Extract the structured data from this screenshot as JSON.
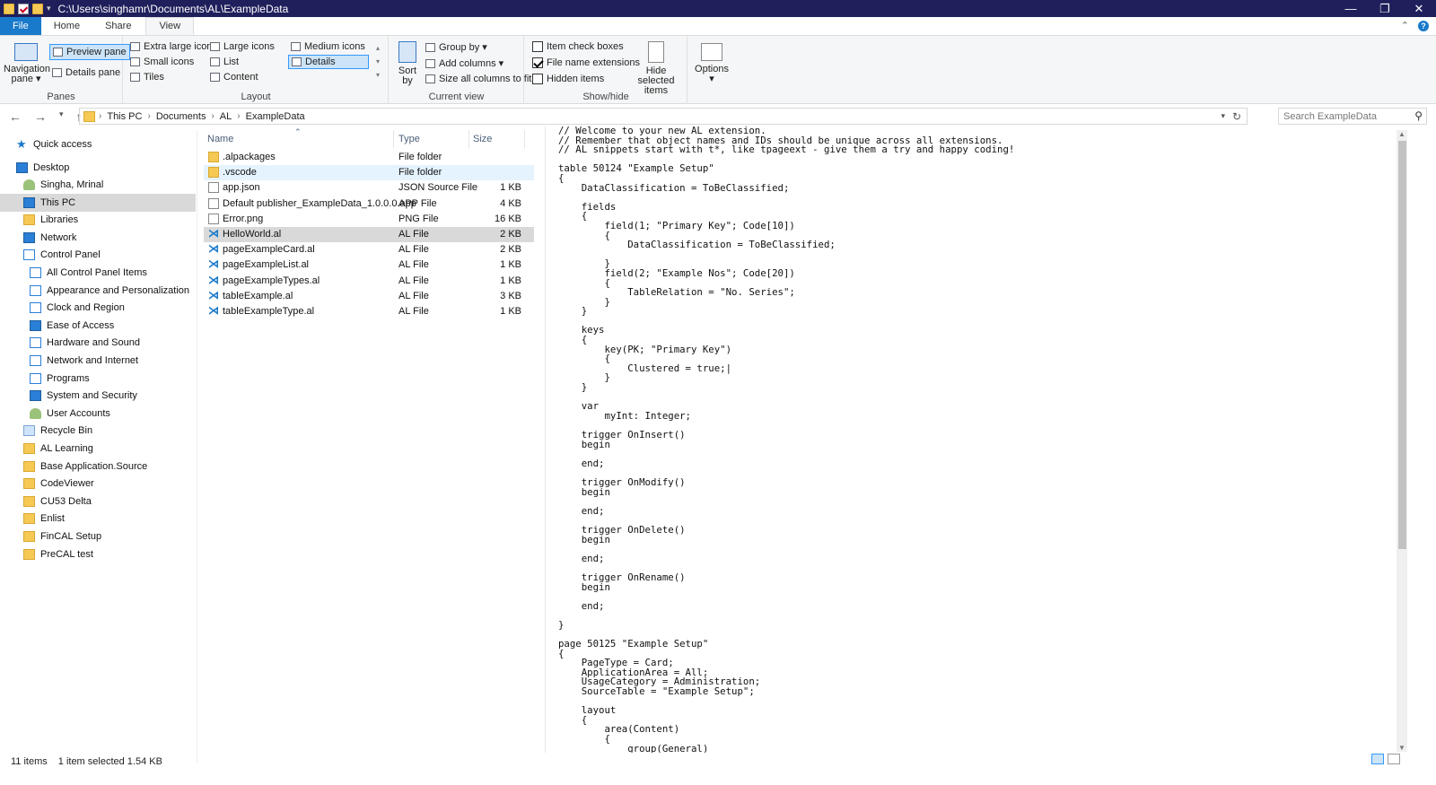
{
  "window": {
    "title_path": "C:\\Users\\singhamr\\Documents\\AL\\ExampleData",
    "minimize": "—",
    "maximize": "❐",
    "close": "✕"
  },
  "ribbon_tabs": [
    "File",
    "Home",
    "Share",
    "View"
  ],
  "ribbon": {
    "panes": {
      "label": "Panes",
      "navigation_pane": "Navigation pane ▾",
      "preview_pane": "Preview pane",
      "details_pane": "Details pane"
    },
    "layout": {
      "label": "Layout",
      "options": [
        "Extra large icons",
        "Large icons",
        "Medium icons",
        "Small icons",
        "List",
        "Details",
        "Tiles",
        "Content"
      ],
      "selected": "Details"
    },
    "current_view": {
      "label": "Current view",
      "sort_by": "Sort by",
      "group_by": "Group by ▾",
      "add_columns": "Add columns ▾",
      "size_all_columns": "Size all columns to fit"
    },
    "show_hide": {
      "label": "Show/hide",
      "item_check_boxes": "Item check boxes",
      "file_name_extensions": "File name extensions",
      "hidden_items": "Hidden items",
      "hide_selected_items": "Hide selected items",
      "checks": {
        "item_check_boxes": false,
        "file_name_extensions": true,
        "hidden_items": false
      }
    },
    "options": "Options"
  },
  "address": {
    "crumbs": [
      "This PC",
      "Documents",
      "AL",
      "ExampleData"
    ],
    "search_placeholder": "Search ExampleData"
  },
  "sidebar": [
    {
      "label": "Quick access",
      "icon": "star-icon"
    },
    {
      "label": "Desktop",
      "icon": "desktop-icon"
    },
    {
      "label": "Singha, Mrinal",
      "icon": "user-icon"
    },
    {
      "label": "This PC",
      "icon": "computer-icon"
    },
    {
      "label": "Libraries",
      "icon": "library-icon"
    },
    {
      "label": "Network",
      "icon": "network-icon"
    },
    {
      "label": "Control Panel",
      "icon": "control-panel-icon"
    },
    {
      "label": "All Control Panel Items",
      "icon": "control-panel-icon"
    },
    {
      "label": "Appearance and Personalization",
      "icon": "appearance-icon"
    },
    {
      "label": "Clock and Region",
      "icon": "clock-icon"
    },
    {
      "label": "Ease of Access",
      "icon": "ease-of-access-icon"
    },
    {
      "label": "Hardware and Sound",
      "icon": "hardware-icon"
    },
    {
      "label": "Network and Internet",
      "icon": "network-icon"
    },
    {
      "label": "Programs",
      "icon": "programs-icon"
    },
    {
      "label": "System and Security",
      "icon": "shield-icon"
    },
    {
      "label": "User Accounts",
      "icon": "users-icon"
    },
    {
      "label": "Recycle Bin",
      "icon": "recycle-bin-icon"
    },
    {
      "label": "AL Learning",
      "icon": "folder-icon"
    },
    {
      "label": "Base Application.Source",
      "icon": "folder-icon"
    },
    {
      "label": "CodeViewer",
      "icon": "folder-icon"
    },
    {
      "label": "CU53 Delta",
      "icon": "folder-icon"
    },
    {
      "label": "Enlist",
      "icon": "folder-icon"
    },
    {
      "label": "FinCAL Setup",
      "icon": "folder-icon"
    },
    {
      "label": "PreCAL test",
      "icon": "folder-icon"
    }
  ],
  "columns": {
    "name": "Name",
    "type": "Type",
    "size": "Size"
  },
  "files": [
    {
      "name": ".alpackages",
      "type": "File folder",
      "size": "",
      "icon": "folder-icon"
    },
    {
      "name": ".vscode",
      "type": "File folder",
      "size": "",
      "icon": "folder-icon"
    },
    {
      "name": "app.json",
      "type": "JSON Source File",
      "size": "1 KB",
      "icon": "document-icon"
    },
    {
      "name": "Default publisher_ExampleData_1.0.0.0.app",
      "type": "APP File",
      "size": "4 KB",
      "icon": "document-icon"
    },
    {
      "name": "Error.png",
      "type": "PNG File",
      "size": "16 KB",
      "icon": "image-icon"
    },
    {
      "name": "HelloWorld.al",
      "type": "AL File",
      "size": "2 KB",
      "icon": "vscode-icon"
    },
    {
      "name": "pageExampleCard.al",
      "type": "AL File",
      "size": "2 KB",
      "icon": "vscode-icon"
    },
    {
      "name": "pageExampleList.al",
      "type": "AL File",
      "size": "1 KB",
      "icon": "vscode-icon"
    },
    {
      "name": "pageExampleTypes.al",
      "type": "AL File",
      "size": "1 KB",
      "icon": "vscode-icon"
    },
    {
      "name": "tableExample.al",
      "type": "AL File",
      "size": "3 KB",
      "icon": "vscode-icon"
    },
    {
      "name": "tableExampleType.al",
      "type": "AL File",
      "size": "1 KB",
      "icon": "vscode-icon"
    }
  ],
  "preview_code": [
    "// Welcome to your new AL extension.",
    "// Remember that object names and IDs should be unique across all extensions.",
    "// AL snippets start with t*, like tpageext - give them a try and happy coding!",
    "",
    "table 50124 \"Example Setup\"",
    "{",
    "    DataClassification = ToBeClassified;",
    "",
    "    fields",
    "    {",
    "        field(1; \"Primary Key\"; Code[10])",
    "        {",
    "            DataClassification = ToBeClassified;",
    "",
    "        }",
    "        field(2; \"Example Nos\"; Code[20])",
    "        {",
    "            TableRelation = \"No. Series\";",
    "        }",
    "    }",
    "",
    "    keys",
    "    {",
    "        key(PK; \"Primary Key\")",
    "        {",
    "            Clustered = true;|",
    "        }",
    "    }",
    "",
    "    var",
    "        myInt: Integer;",
    "",
    "    trigger OnInsert()",
    "    begin",
    "",
    "    end;",
    "",
    "    trigger OnModify()",
    "    begin",
    "",
    "    end;",
    "",
    "    trigger OnDelete()",
    "    begin",
    "",
    "    end;",
    "",
    "    trigger OnRename()",
    "    begin",
    "",
    "    end;",
    "",
    "}",
    "",
    "page 50125 \"Example Setup\"",
    "{",
    "    PageType = Card;",
    "    ApplicationArea = All;",
    "    UsageCategory = Administration;",
    "    SourceTable = \"Example Setup\";",
    "",
    "    layout",
    "    {",
    "        area(Content)",
    "        {",
    "            group(General)"
  ],
  "status": {
    "items": "11 items",
    "selected": "1 item selected  1.54 KB"
  },
  "colors": {
    "file_tab": "#1979ca",
    "titlebar": "#1f1f5c",
    "selection": "#cce4f7"
  }
}
